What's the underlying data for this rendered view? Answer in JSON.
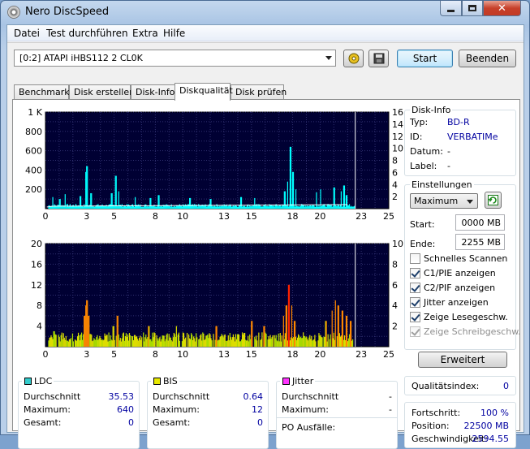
{
  "window": {
    "title": "Nero DiscSpeed"
  },
  "menu": [
    "Datei",
    "Test durchführen",
    "Extra",
    "Hilfe"
  ],
  "toolbar": {
    "drive": "[0:2]   ATAPI iHBS112   2 CL0K",
    "start_label": "Start",
    "exit_label": "Beenden"
  },
  "tabs": [
    {
      "label": "Benchmark",
      "active": false
    },
    {
      "label": "Disk erstellen",
      "active": false
    },
    {
      "label": "Disk-Info",
      "active": false
    },
    {
      "label": "Diskqualität",
      "active": true
    },
    {
      "label": "Disk prüfen",
      "active": false
    }
  ],
  "disc_info": {
    "title": "Disk-Info",
    "rows": [
      {
        "label": "Typ:",
        "value": "BD-R"
      },
      {
        "label": "ID:",
        "value": "VERBATIMe"
      },
      {
        "label": "Datum:",
        "value": "-"
      },
      {
        "label": "Label:",
        "value": "-"
      }
    ]
  },
  "settings": {
    "title": "Einstellungen",
    "speed": "Maximum",
    "start_label": "Start:",
    "start_value": "0000 MB",
    "end_label": "Ende:",
    "end_value": "2255 MB",
    "checkboxes": [
      {
        "label": "Schnelles Scannen",
        "checked": false,
        "disabled": false
      },
      {
        "label": "C1/PIE anzeigen",
        "checked": true,
        "disabled": false
      },
      {
        "label": "C2/PIF anzeigen",
        "checked": true,
        "disabled": false
      },
      {
        "label": "Jitter anzeigen",
        "checked": true,
        "disabled": false
      },
      {
        "label": "Zeige Lesegeschw.",
        "checked": true,
        "disabled": false
      },
      {
        "label": "Zeige Schreibgeschw.",
        "checked": true,
        "disabled": true
      }
    ],
    "advanced_label": "Erweitert"
  },
  "quality": {
    "label": "Qualitätsindex:",
    "value": "0"
  },
  "progress": {
    "rows": [
      {
        "label": "Fortschritt:",
        "value": "100 %"
      },
      {
        "label": "Position:",
        "value": "22500 MB"
      },
      {
        "label": "Geschwindigkeit:",
        "value": "2594.55"
      }
    ]
  },
  "stats": {
    "ldc": {
      "title": "LDC",
      "color": "#33cccc",
      "rows": [
        {
          "label": "Durchschnitt",
          "value": "35.53"
        },
        {
          "label": "Maximum:",
          "value": "640"
        },
        {
          "label": "Gesamt:",
          "value": "0"
        }
      ]
    },
    "bis": {
      "title": "BIS",
      "color": "#e8e800",
      "rows": [
        {
          "label": "Durchschnitt",
          "value": "0.64"
        },
        {
          "label": "Maximum:",
          "value": "12"
        },
        {
          "label": "Gesamt:",
          "value": "0"
        }
      ]
    },
    "jitter": {
      "title": "Jitter",
      "color": "#ff33ff",
      "rows": [
        {
          "label": "Durchschnitt",
          "value": "-"
        },
        {
          "label": "Maximum:",
          "value": "-"
        },
        {
          "label": "PO Ausfälle:",
          "value": ""
        }
      ]
    }
  },
  "chart_data": [
    {
      "type": "bar",
      "name": "LDC",
      "x_ticks": [
        0,
        3,
        5,
        8,
        10,
        13,
        15,
        18,
        20,
        23,
        25
      ],
      "xlim": [
        0,
        25
      ],
      "y_left_ticks": [
        "200",
        "400",
        "600",
        "800",
        "1 K"
      ],
      "ylim_left": [
        0,
        1000
      ],
      "y_right_ticks": [
        2,
        4,
        6,
        8,
        10,
        12,
        14,
        16
      ],
      "ylim_right": [
        0,
        16
      ],
      "colors": {
        "bars": "#00ffff",
        "speed_line": "#ffffff",
        "background": "#000033"
      },
      "data_end_x": 22.5,
      "baseline": 35,
      "peaks": [
        {
          "x": 0.5,
          "y": 120
        },
        {
          "x": 1.0,
          "y": 100
        },
        {
          "x": 1.4,
          "y": 150
        },
        {
          "x": 2.5,
          "y": 130
        },
        {
          "x": 2.9,
          "y": 380
        },
        {
          "x": 3.0,
          "y": 440
        },
        {
          "x": 3.3,
          "y": 160
        },
        {
          "x": 4.8,
          "y": 160
        },
        {
          "x": 5.1,
          "y": 340
        },
        {
          "x": 5.3,
          "y": 180
        },
        {
          "x": 6.5,
          "y": 120
        },
        {
          "x": 7.6,
          "y": 110
        },
        {
          "x": 8.2,
          "y": 140
        },
        {
          "x": 10.5,
          "y": 110
        },
        {
          "x": 12.0,
          "y": 100
        },
        {
          "x": 14.2,
          "y": 120
        },
        {
          "x": 15.2,
          "y": 110
        },
        {
          "x": 17.4,
          "y": 180
        },
        {
          "x": 17.6,
          "y": 280
        },
        {
          "x": 17.8,
          "y": 640
        },
        {
          "x": 18.0,
          "y": 380
        },
        {
          "x": 18.2,
          "y": 200
        },
        {
          "x": 19.7,
          "y": 170
        },
        {
          "x": 20.0,
          "y": 200
        },
        {
          "x": 21.0,
          "y": 220
        },
        {
          "x": 21.5,
          "y": 180
        },
        {
          "x": 21.7,
          "y": 240
        },
        {
          "x": 21.9,
          "y": 140
        }
      ]
    },
    {
      "type": "bar",
      "name": "BIS",
      "x_ticks": [
        0,
        3,
        5,
        8,
        10,
        13,
        15,
        18,
        20,
        23,
        25
      ],
      "xlim": [
        0,
        25
      ],
      "y_left_ticks": [
        4,
        8,
        12,
        16,
        20
      ],
      "ylim_left": [
        0,
        20
      ],
      "y_right_ticks": [
        2,
        4,
        6,
        8,
        10
      ],
      "ylim_right": [
        0,
        10
      ],
      "colors": {
        "low": "#dddd00",
        "mid": "#aadd00",
        "high": "#ff8800",
        "peak": "#ff2200",
        "background": "#000033"
      },
      "data_end_x": 22.5,
      "baseline": 2,
      "peaks": [
        {
          "x": 0.6,
          "y": 3
        },
        {
          "x": 2.8,
          "y": 6
        },
        {
          "x": 2.9,
          "y": 8
        },
        {
          "x": 3.0,
          "y": 9
        },
        {
          "x": 3.1,
          "y": 6
        },
        {
          "x": 4.9,
          "y": 4
        },
        {
          "x": 5.2,
          "y": 6
        },
        {
          "x": 7.5,
          "y": 4
        },
        {
          "x": 9.5,
          "y": 4
        },
        {
          "x": 12.4,
          "y": 4
        },
        {
          "x": 15.0,
          "y": 5
        },
        {
          "x": 15.9,
          "y": 4
        },
        {
          "x": 17.3,
          "y": 6
        },
        {
          "x": 17.5,
          "y": 8
        },
        {
          "x": 17.7,
          "y": 12
        },
        {
          "x": 17.9,
          "y": 8
        },
        {
          "x": 18.1,
          "y": 5
        },
        {
          "x": 20.4,
          "y": 5
        },
        {
          "x": 20.8,
          "y": 7
        },
        {
          "x": 21.1,
          "y": 9
        },
        {
          "x": 21.3,
          "y": 8
        },
        {
          "x": 21.6,
          "y": 7
        },
        {
          "x": 21.9,
          "y": 6
        },
        {
          "x": 22.2,
          "y": 5
        }
      ]
    }
  ]
}
